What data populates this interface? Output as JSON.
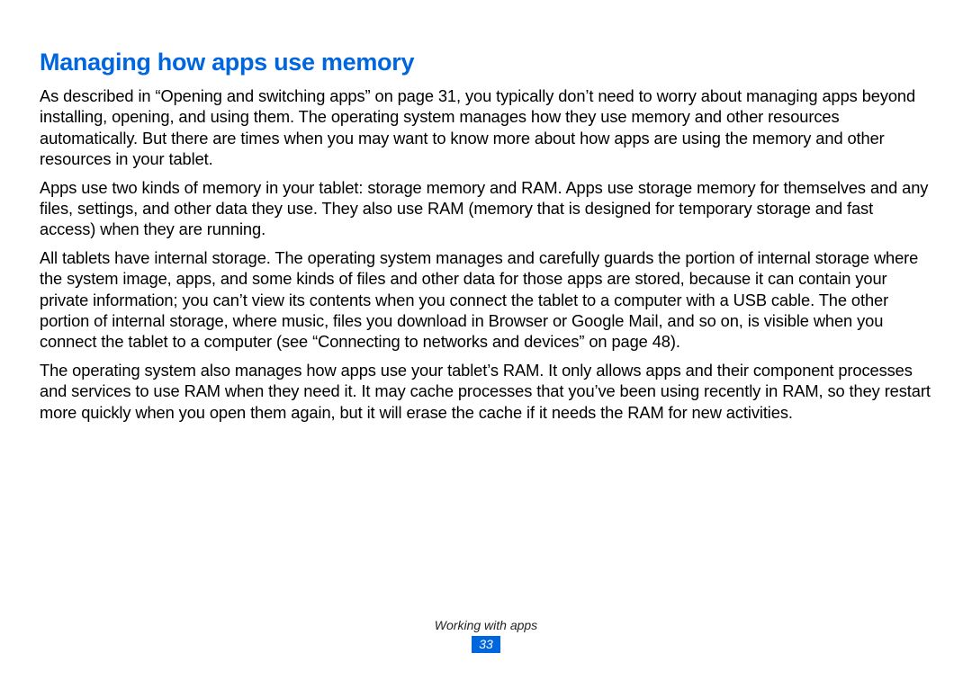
{
  "heading": "Managing how apps use memory",
  "paragraphs": [
    "As described in “Opening and switching apps” on page 31, you typically don’t need to worry about managing apps beyond installing, opening, and using them. The operating system manages how they use memory and other resources automatically. But there are times when you may want to know more about how apps are using the memory and other resources in your tablet.",
    "Apps use two kinds of memory in your tablet: storage memory and RAM. Apps use storage memory for themselves and any files, settings, and other data they use. They also use RAM (memory that is designed for temporary storage and fast access) when they are running.",
    "All tablets have internal storage. The operating system manages and carefully guards the portion of internal storage where the system image, apps, and some kinds of files and other data for those apps are stored, because it can contain your private information; you can’t view its contents when you connect the tablet to a computer with a USB cable. The other portion of internal storage, where music, files you download in Browser or Google Mail, and so on, is visible when you connect the tablet to a computer (see “Connecting to networks and devices” on page 48).",
    "The operating system also manages how apps use your tablet’s RAM. It only allows apps and their component processes and services to use RAM when they need it. It may cache processes that you’ve been using recently in RAM, so they restart more quickly when you open them again, but it will erase the cache if it needs the RAM for new activities."
  ],
  "footer": {
    "section": "Working with apps",
    "page": "33"
  }
}
